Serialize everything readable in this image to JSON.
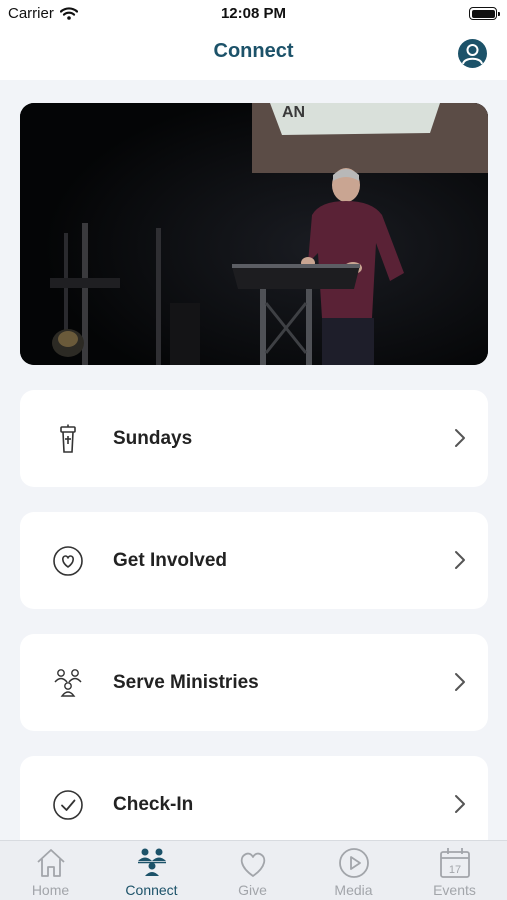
{
  "status_bar": {
    "carrier": "Carrier",
    "time": "12:08 PM"
  },
  "nav": {
    "title": "Connect"
  },
  "menu": [
    {
      "label": "Sundays",
      "icon": "podium-icon"
    },
    {
      "label": "Get Involved",
      "icon": "heart-circle-icon"
    },
    {
      "label": "Serve Ministries",
      "icon": "people-group-icon"
    },
    {
      "label": "Check-In",
      "icon": "check-circle-icon"
    }
  ],
  "tabs": [
    {
      "label": "Home",
      "icon": "home-icon",
      "active": false
    },
    {
      "label": "Connect",
      "icon": "connect-people-icon",
      "active": true
    },
    {
      "label": "Give",
      "icon": "heart-icon",
      "active": false
    },
    {
      "label": "Media",
      "icon": "play-circle-icon",
      "active": false
    },
    {
      "label": "Events",
      "icon": "calendar-icon",
      "active": false,
      "badge": "17"
    }
  ],
  "colors": {
    "accent": "#1c5269",
    "inactive_tab": "#a2a5aa",
    "background": "#f2f4f8",
    "card": "#ffffff"
  }
}
